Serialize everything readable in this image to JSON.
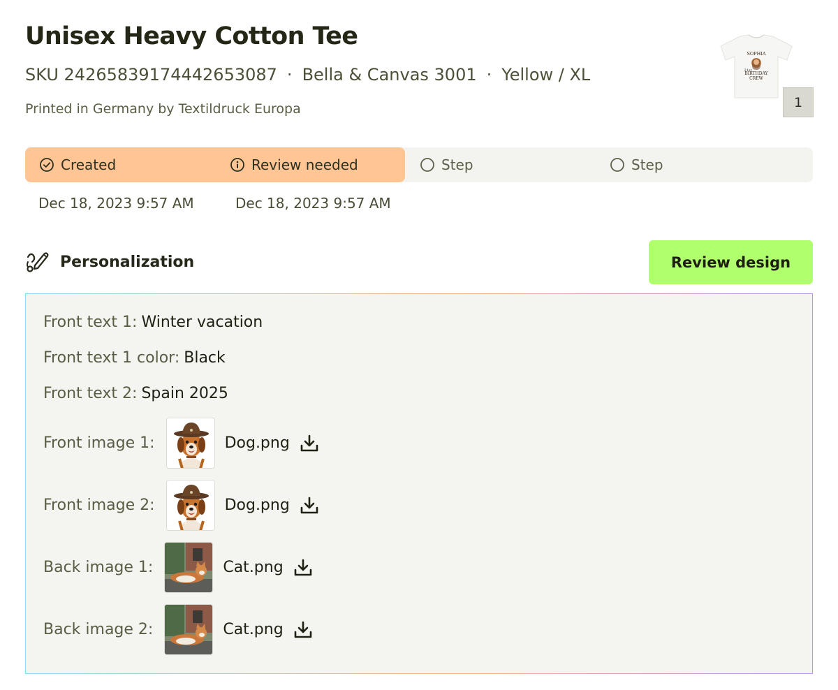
{
  "product": {
    "title": "Unisex Heavy Cotton Tee",
    "sku": "SKU 24265839174442653087",
    "brand": "Bella & Canvas 3001",
    "variant": "Yellow / XL",
    "printed_by": "Printed in Germany by Textildruck Europa",
    "quantity": "1",
    "mockup_text": {
      "line1": "SOPHIA",
      "line2": "21st",
      "line3": "BIRTHDAY",
      "line4": "CREW"
    }
  },
  "progress": {
    "steps": [
      {
        "label": "Created",
        "date": "Dec 18, 2023 9:57 AM",
        "status": "done",
        "icon": "check-circle-icon"
      },
      {
        "label": "Review needed",
        "date": "Dec 18, 2023 9:57 AM",
        "status": "done",
        "icon": "info-circle-icon"
      },
      {
        "label": "Step",
        "status": "pending",
        "icon": "empty-circle-icon"
      },
      {
        "label": "Step",
        "status": "pending",
        "icon": "empty-circle-icon"
      }
    ],
    "active_color": "#ffc594"
  },
  "personalization": {
    "heading": "Personalization",
    "heading_icon": "personalization-pencil-icon",
    "review_button": "Review design",
    "review_button_color": "#b0ff6c",
    "fields": [
      {
        "label": "Front text 1:",
        "value": "Winter vacation"
      },
      {
        "label": "Front text 1 color:",
        "value": "Black"
      },
      {
        "label": "Front text 2:",
        "value": "Spain 2025"
      }
    ],
    "images": [
      {
        "label": "Front image 1:",
        "file": "Dog.png",
        "thumb": "dog"
      },
      {
        "label": "Front image 2:",
        "file": "Dog.png",
        "thumb": "dog"
      },
      {
        "label": "Back image 1:",
        "file": "Cat.png",
        "thumb": "cat"
      },
      {
        "label": "Back image 2:",
        "file": "Cat.png",
        "thumb": "cat"
      }
    ],
    "download_icon": "download-icon"
  }
}
